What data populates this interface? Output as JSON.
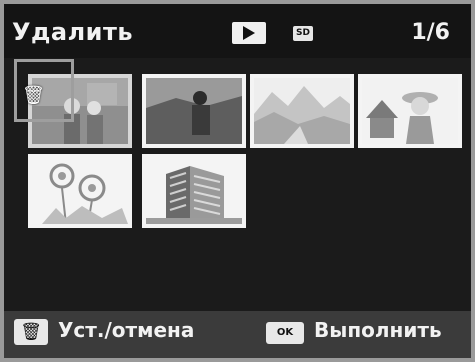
{
  "header": {
    "title": "Удалить",
    "sd_label": "SD",
    "counter": "1/6",
    "mode_icon": "play-icon"
  },
  "grid": {
    "thumbnails": [
      {
        "subject": "couple-portrait",
        "selected": true
      },
      {
        "subject": "man-outdoors",
        "selected": false
      },
      {
        "subject": "mountain-landscape",
        "selected": false
      },
      {
        "subject": "woman-with-hat-temple",
        "selected": false
      },
      {
        "subject": "flowers",
        "selected": false
      },
      {
        "subject": "building",
        "selected": false
      }
    ],
    "selection_icon": "trash-icon"
  },
  "footer": {
    "trash_key_icon": "trash-icon",
    "toggle_label": "Уст./отмена",
    "ok_key_label": "OK",
    "execute_label": "Выполнить"
  }
}
